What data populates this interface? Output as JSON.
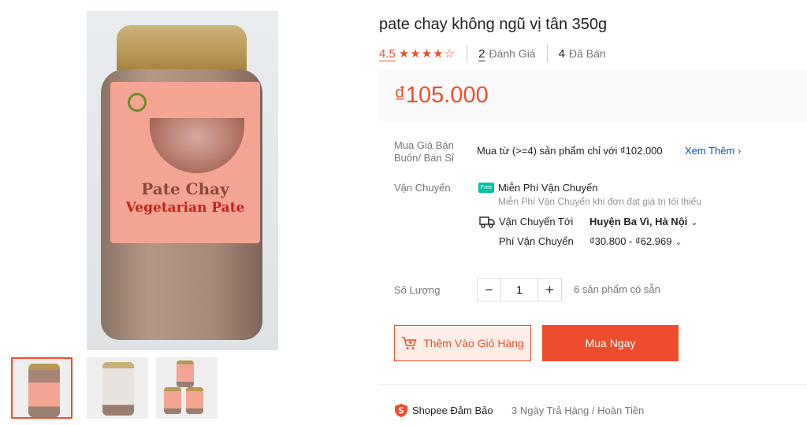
{
  "product": {
    "title": "pate chay không ngũ vị tân 350g",
    "rating": "4.5",
    "stars": "★★★★☆",
    "reviews_count": "2",
    "reviews_label": "Đánh Giá",
    "sold_count": "4",
    "sold_label": "Đã Bán",
    "price": "₫105.000"
  },
  "image": {
    "jar_title": "Pate Chay",
    "jar_subtitle": "Vegetarian Pate",
    "thumbnail_count": 3
  },
  "wholesale": {
    "label": "Mua Giá Bán Buôn/ Bán Sỉ",
    "text": "Mua từ (>=4) sản phẩm chỉ với ₫102.000",
    "see_more": "Xem Thêm"
  },
  "shipping": {
    "label": "Vận Chuyển",
    "free_badge": "Free",
    "free_title": "Miễn Phí Vận Chuyển",
    "free_desc": "Miễn Phí Vận Chuyển khi đơn đạt giá trị tối thiểu",
    "ship_to_label": "Vận Chuyển Tới",
    "ship_to_value": "Huyện Ba Vì, Hà Nội",
    "fee_label": "Phí Vận Chuyển",
    "fee_value": "₫30.800 - ₫62.969"
  },
  "quantity": {
    "label": "Số Lượng",
    "minus": "−",
    "value": "1",
    "plus": "+",
    "stock": "6 sản phẩm có sẵn"
  },
  "actions": {
    "add_to_cart": "Thêm Vào Giỏ Hàng",
    "buy_now": "Mua Ngay"
  },
  "guarantee": {
    "title": "Shopee Đảm Bảo",
    "desc": "3 Ngày Trả Hàng / Hoàn Tiền"
  },
  "colors": {
    "accent": "#ee4d2d",
    "link": "#0055aa",
    "free_badge": "#00bfa5"
  }
}
